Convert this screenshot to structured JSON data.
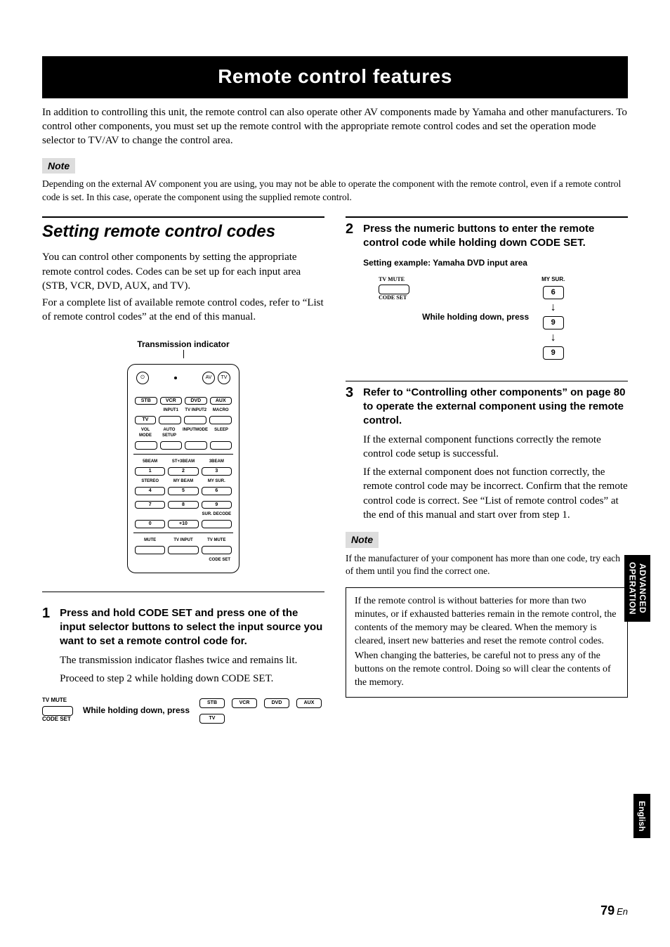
{
  "title": "Remote control features",
  "intro": "In addition to controlling this unit, the remote control can also operate other AV components made by Yamaha and other manufacturers. To control other components, you must set up the remote control with the appropriate remote control codes and set the operation mode selector to TV/AV to change the control area.",
  "note_label": "Note",
  "note_body": "Depending on the external AV component you are using, you may not be able to operate the component with the remote control, even if a remote control code is set. In this case, operate the component using the supplied remote control.",
  "section_head": "Setting remote control codes",
  "section_body1": "You can control other components by setting the appropriate remote control codes. Codes can be set up for each input area (STB, VCR, DVD, AUX, and TV).",
  "section_body2": "For a complete list of available remote control codes, refer to “List of remote control codes” at the end of this manual.",
  "tx_indicator": "Transmission indicator",
  "remote": {
    "top": {
      "av": "AV",
      "tv": "TV",
      "power": "⏻"
    },
    "row_inputs": [
      "STB",
      "VCR",
      "DVD",
      "AUX"
    ],
    "row_inputs2_lbl": [
      "",
      "INPUT1",
      "TV INPUT2",
      "MACRO"
    ],
    "row_tv": "TV",
    "row_mode_lbl": [
      "VOL MODE",
      "AUTO SETUP",
      "INPUTMODE",
      "SLEEP"
    ],
    "np_lbl_r1": [
      "5BEAM",
      "ST+3BEAM",
      "3BEAM"
    ],
    "np_r1": [
      "1",
      "2",
      "3"
    ],
    "np_lbl_r2": [
      "STEREO",
      "MY BEAM",
      "MY SUR."
    ],
    "np_r2": [
      "4",
      "5",
      "6"
    ],
    "np_r3": [
      "7",
      "8",
      "9"
    ],
    "np_r4": [
      "0",
      "+10",
      ""
    ],
    "np_lbl_r4": [
      "",
      "",
      "SUR. DECODE"
    ],
    "bottom_lbl": [
      "MUTE",
      "TV INPUT",
      "TV MUTE"
    ],
    "code_set": "CODE SET"
  },
  "step1_num": "1",
  "step1_title": "Press and hold CODE SET and press one of the input selector buttons to select the input source you want to set a remote control code for.",
  "step1_text1": "The transmission indicator flashes twice and remains lit.",
  "step1_text2": "Proceed to step 2 while holding down CODE SET.",
  "illus1": {
    "tv_mute": "TV MUTE",
    "code_set": "CODE SET",
    "hold": "While holding down, press",
    "inputs": [
      "STB",
      "VCR",
      "DVD",
      "AUX"
    ],
    "tv": "TV"
  },
  "step2_num": "2",
  "step2_title": "Press the numeric buttons to enter the remote control code while holding down CODE SET.",
  "step2_example": "Setting example: Yamaha DVD input area",
  "illus2": {
    "tv_mute": "TV MUTE",
    "code_set": "CODE SET",
    "hold": "While holding down, press",
    "my_sur": "MY SUR.",
    "digits": [
      "6",
      "9",
      "9"
    ]
  },
  "step3_num": "3",
  "step3_title": "Refer to “Controlling other components” on page 80 to operate the external component using the remote control.",
  "step3_text1": "If the external component functions correctly the remote control code setup is successful.",
  "step3_text2": "If the external component does not function correctly, the remote control code may be incorrect. Confirm that the remote control code is correct. See “List of remote control codes” at the end of this manual and start over from step 1.",
  "note2_body": "If the manufacturer of your component has more than one code, try each of them until you find the correct one.",
  "battery_box1": "If the remote control is without batteries for more than two minutes, or if exhausted batteries remain in the remote control, the contents of the memory may be cleared. When the memory is cleared, insert new batteries and reset the remote control codes.",
  "battery_box2": "When changing the batteries, be careful not to press any of the buttons on the remote control. Doing so will clear the contents of the memory.",
  "side_tab_l1": "ADVANCED",
  "side_tab_l2": "OPERATION",
  "side_lang": "English",
  "page_number": "79",
  "page_lang_suffix": "En"
}
